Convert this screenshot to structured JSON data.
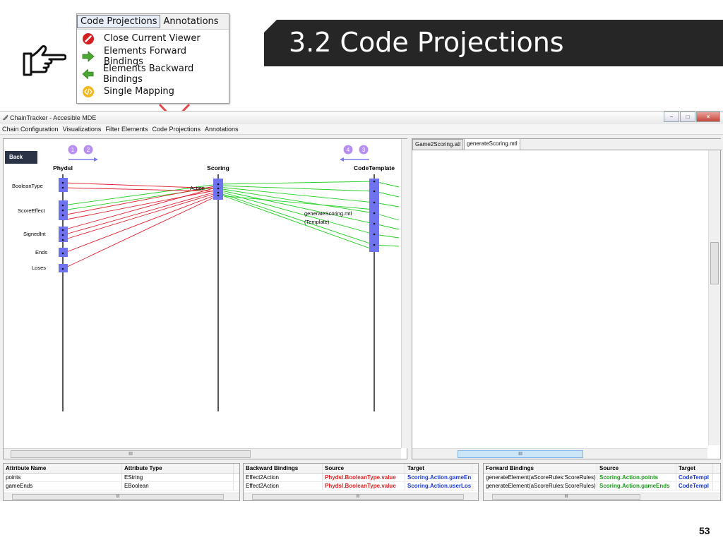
{
  "slide": {
    "title": "3.2 Code Projections",
    "page_number": "53"
  },
  "menu_popup": {
    "tabs": [
      "Code Projections",
      "Annotations"
    ],
    "items": [
      {
        "label": "Close Current Viewer",
        "icon": "close-viewer-icon"
      },
      {
        "label": "Elements Forward Bindings",
        "icon": "forward-arrow-icon"
      },
      {
        "label": "Elements Backward Bindings",
        "icon": "backward-arrow-icon"
      },
      {
        "label": "Single Mapping",
        "icon": "code-mapping-icon"
      }
    ]
  },
  "app": {
    "title": "ChainTracker - Accesible MDE",
    "window_buttons": [
      "−",
      "□",
      "×"
    ],
    "menu": [
      "Chain Configuration",
      "Visualizations",
      "Filter Elements",
      "Code Projections",
      "Annotations"
    ]
  },
  "diagram": {
    "back_label": "Back",
    "badges_left": [
      "1",
      "2"
    ],
    "badges_right": [
      "4",
      "3"
    ],
    "columns": [
      "Phydsl",
      "Scoring",
      "CodeTemplate"
    ],
    "left_elements": [
      "BooleanType",
      "ScoreEffect",
      "SignedInt",
      "Ends",
      "Loses"
    ],
    "middle_label": "Action",
    "template_label_line1": "generateScoring.mtl",
    "template_label_line2": "(Template)",
    "scroll_label": "III"
  },
  "editor": {
    "tabs": [
      "Game2Scoring.atl",
      "generateScoring.mtl"
    ],
    "scroll_label": "III"
  },
  "tables": {
    "attributes": {
      "headers": [
        "Attribute Name",
        "Attribute Type"
      ],
      "rows": [
        [
          "points",
          "EString"
        ],
        [
          "gameEnds",
          "EBoolean"
        ]
      ]
    },
    "backward": {
      "headers": [
        "Backward Bindings",
        "Source",
        "Target"
      ],
      "rows": [
        [
          "Effect2Action",
          "Phydsl.BooleanType.value",
          "Scoring.Action.gameEn"
        ],
        [
          "Effect2Action",
          "Phydsl.BooleanType.value",
          "Scoring.Action.userLos"
        ]
      ]
    },
    "forward": {
      "headers": [
        "Forward Bindings",
        "Source",
        "Target"
      ],
      "rows": [
        [
          "generateElement(aScoreRules:ScoreRules)",
          "Scoring.Action.points",
          "CodeTempl"
        ],
        [
          "generateElement(aScoreRules:ScoreRules)",
          "Scoring.Action.gameEnds",
          "CodeTempl"
        ]
      ]
    },
    "scroll_label": "III"
  },
  "colors": {
    "banner": "#262626",
    "node_fill": "#6f73f0",
    "backward_link": "#e0202f",
    "forward_link": "#22d022"
  }
}
